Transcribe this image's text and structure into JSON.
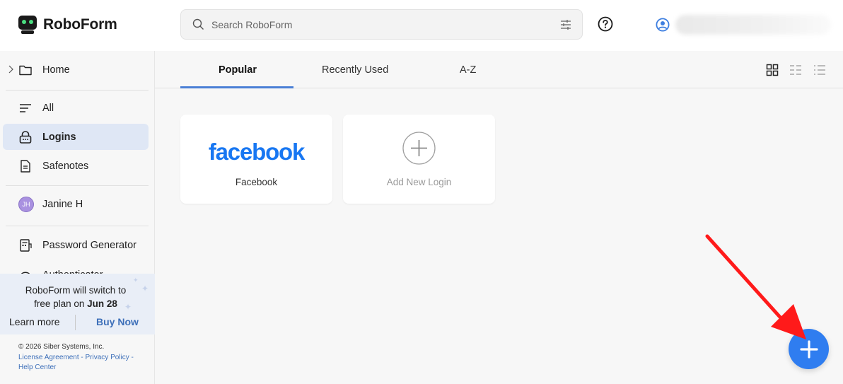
{
  "app": {
    "name": "RoboForm"
  },
  "header": {
    "search_placeholder": "Search RoboForm"
  },
  "sidebar": {
    "home": "Home",
    "items": [
      {
        "label": "All"
      },
      {
        "label": "Logins"
      },
      {
        "label": "Safenotes"
      }
    ],
    "identity": {
      "initials": "JH",
      "name": "Janine H"
    },
    "tools": [
      {
        "label": "Password Generator"
      },
      {
        "label": "Authenticator"
      }
    ],
    "promo": {
      "line1": "RoboForm will switch to",
      "line2_prefix": "free plan on ",
      "line2_date": "Jun 28",
      "learn_more": "Learn more",
      "buy_now": "Buy Now"
    },
    "footer": {
      "copyright": "© 2026 Siber Systems, Inc.",
      "license": "License Agreement",
      "sep1": " - ",
      "privacy": "Privacy Policy",
      "sep2": " -",
      "help": "Help Center"
    }
  },
  "main": {
    "tabs": [
      {
        "label": "Popular",
        "active": true
      },
      {
        "label": "Recently Used"
      },
      {
        "label": "A-Z"
      }
    ],
    "cards": [
      {
        "logo_text": "facebook",
        "label": "Facebook"
      },
      {
        "label": "Add New Login"
      }
    ]
  },
  "colors": {
    "accent": "#2f7df0",
    "active_nav": "#dfe7f5",
    "facebook_blue": "#1877f2",
    "arrow_red": "#ff1a1a"
  }
}
